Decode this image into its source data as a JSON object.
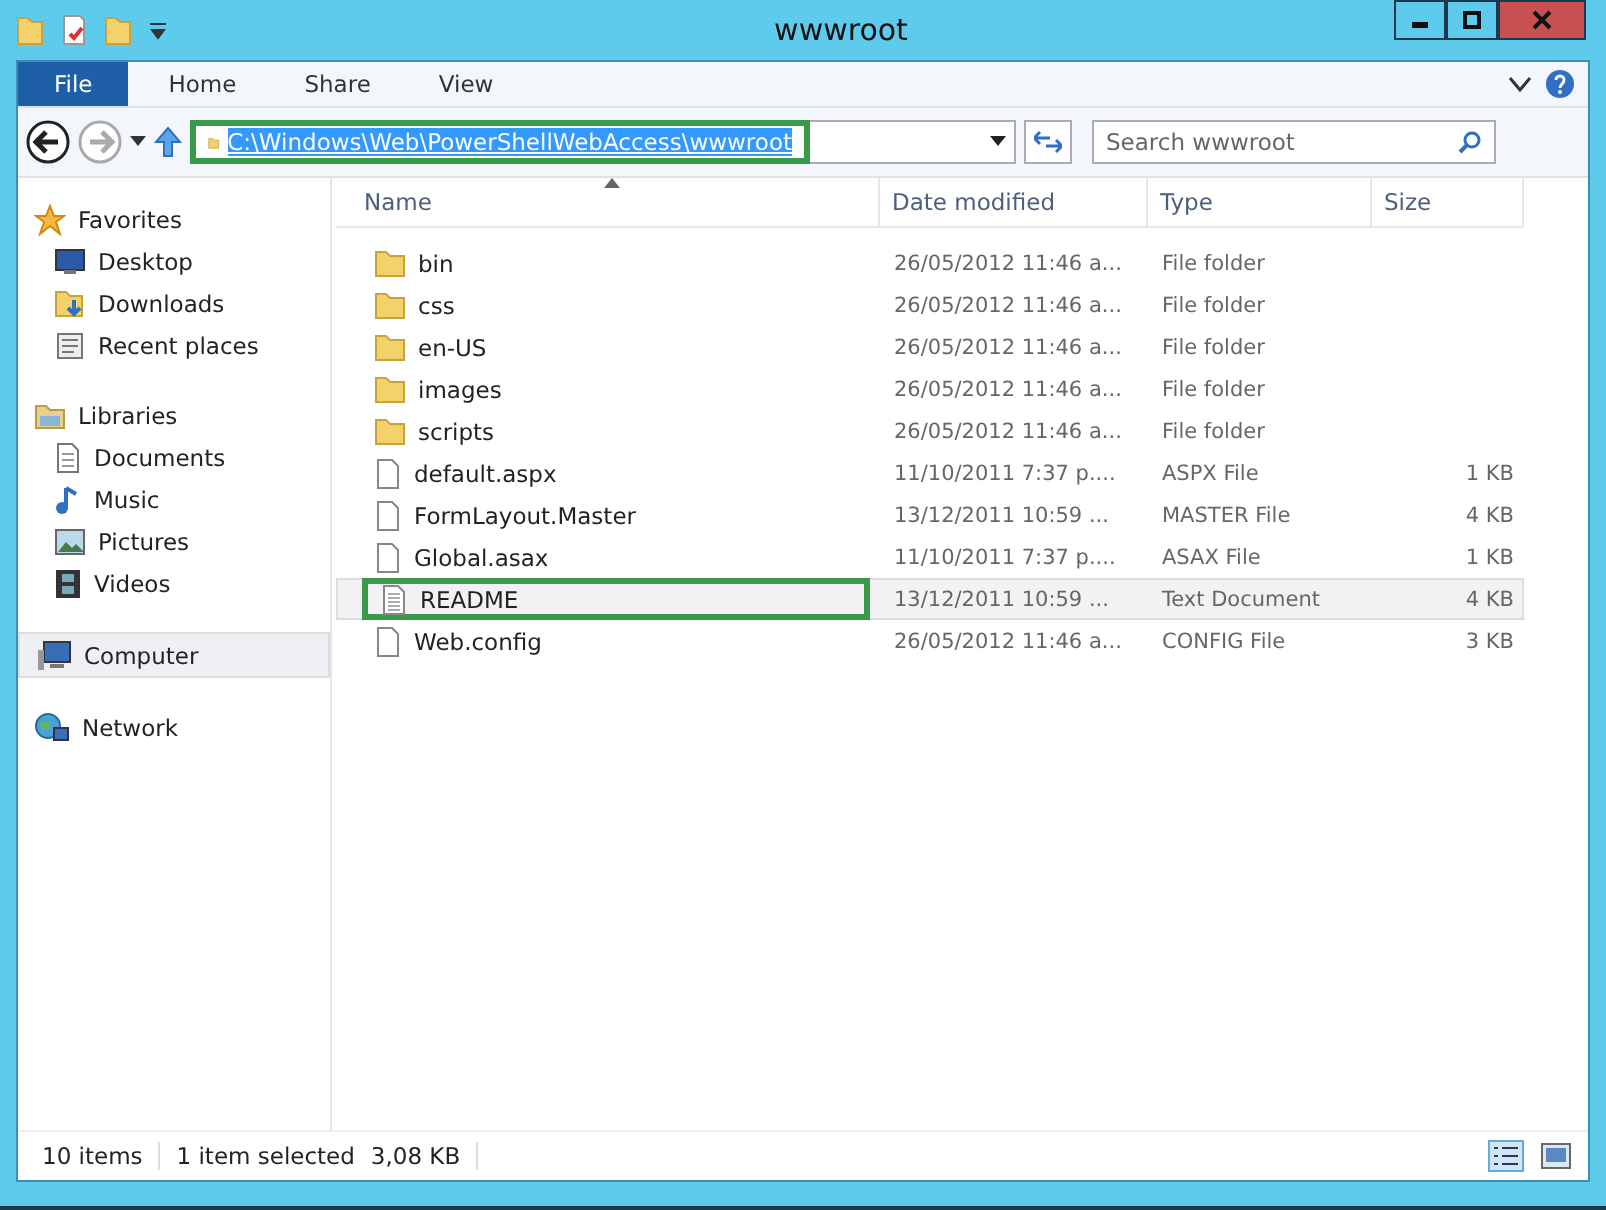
{
  "window": {
    "title": "wwwroot"
  },
  "ribbon_tabs": [
    {
      "label": "File",
      "kind": "file",
      "selected": false
    },
    {
      "label": "Home",
      "kind": "tab",
      "selected": false
    },
    {
      "label": "Share",
      "kind": "tab",
      "selected": false
    },
    {
      "label": "View",
      "kind": "tab",
      "selected": false
    }
  ],
  "address": {
    "value": "C:\\Windows\\Web\\PowerShellWebAccess\\wwwroot",
    "selected": true,
    "highlighted": true
  },
  "search": {
    "placeholder": "Search wwwroot"
  },
  "sidebar": [
    {
      "label": "Favorites",
      "kind": "star",
      "children": [
        {
          "label": "Desktop",
          "kind": "desktop",
          "selected": false
        },
        {
          "label": "Downloads",
          "kind": "downloads",
          "selected": false
        },
        {
          "label": "Recent places",
          "kind": "recent",
          "selected": false
        }
      ]
    },
    {
      "label": "Libraries",
      "kind": "libraries",
      "children": [
        {
          "label": "Documents",
          "kind": "documents",
          "selected": false
        },
        {
          "label": "Music",
          "kind": "music",
          "selected": false
        },
        {
          "label": "Pictures",
          "kind": "pictures",
          "selected": false
        },
        {
          "label": "Videos",
          "kind": "videos",
          "selected": false
        }
      ]
    },
    {
      "label": "Computer",
      "kind": "computer",
      "selected": true
    },
    {
      "label": "Network",
      "kind": "network",
      "selected": false
    }
  ],
  "table": {
    "columns": [
      "Name",
      "Date modified",
      "Type",
      "Size"
    ],
    "rows": [
      {
        "name": "bin",
        "kind": "folder",
        "date": "26/05/2012 11:46 a...",
        "type": "File folder",
        "selected": false,
        "highlighted": false
      },
      {
        "name": "css",
        "kind": "folder",
        "date": "26/05/2012 11:46 a...",
        "type": "File folder",
        "selected": false,
        "highlighted": false
      },
      {
        "name": "en-US",
        "kind": "folder",
        "date": "26/05/2012 11:46 a...",
        "type": "File folder",
        "selected": false,
        "highlighted": false
      },
      {
        "name": "images",
        "kind": "folder",
        "date": "26/05/2012 11:46 a...",
        "type": "File folder",
        "selected": false,
        "highlighted": false
      },
      {
        "name": "scripts",
        "kind": "folder",
        "date": "26/05/2012 11:46 a...",
        "type": "File folder",
        "selected": false,
        "highlighted": false
      },
      {
        "name": "default.aspx",
        "kind": "file",
        "date": "11/10/2011 7:37 p....",
        "type": "ASPX File",
        "size": "1 KB",
        "selected": false,
        "highlighted": false
      },
      {
        "name": "FormLayout.Master",
        "kind": "file",
        "date": "13/12/2011 10:59 ...",
        "type": "MASTER File",
        "size": "4 KB",
        "selected": false,
        "highlighted": false
      },
      {
        "name": "Global.asax",
        "kind": "file",
        "date": "11/10/2011 7:37 p....",
        "type": "ASAX File",
        "size": "1 KB",
        "selected": false,
        "highlighted": false
      },
      {
        "name": "README",
        "kind": "text",
        "date": "13/12/2011 10:59 ...",
        "type": "Text Document",
        "size": "4 KB",
        "selected": true,
        "highlighted": true
      },
      {
        "name": "Web.config",
        "kind": "file",
        "date": "26/05/2012 11:46 a...",
        "type": "CONFIG File",
        "size": "3 KB",
        "selected": false,
        "highlighted": false
      }
    ]
  },
  "status_bar": {
    "count": "10 items",
    "selection": "1 item selected",
    "size": "3,08 KB"
  }
}
